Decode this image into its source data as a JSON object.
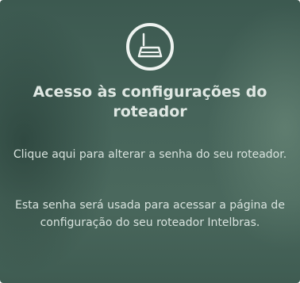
{
  "card": {
    "icon": "router-icon",
    "title": "Acesso às configurações do roteador",
    "description_primary": "Clique aqui para alterar a senha do seu roteador.",
    "description_secondary": "Esta senha será usada para acessar a página de configuração do seu roteador Intelbras."
  }
}
